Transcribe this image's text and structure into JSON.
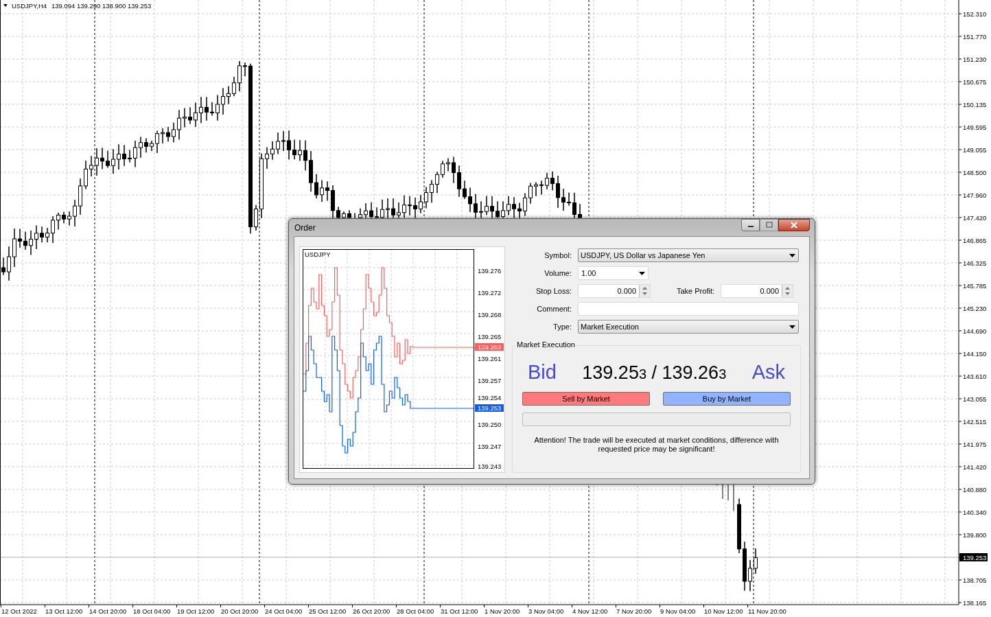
{
  "chart": {
    "header": {
      "symbol": "USDJPY,H4",
      "prices": "139.094 139.290 138.900 139.253"
    },
    "price_axis": [
      {
        "label": "152.310",
        "current": false
      },
      {
        "label": "151.770",
        "current": false
      },
      {
        "label": "151.230",
        "current": false
      },
      {
        "label": "150.675",
        "current": false
      },
      {
        "label": "150.135",
        "current": false
      },
      {
        "label": "149.595",
        "current": false
      },
      {
        "label": "149.055",
        "current": false
      },
      {
        "label": "148.500",
        "current": false
      },
      {
        "label": "147.960",
        "current": false
      },
      {
        "label": "147.420",
        "current": false
      },
      {
        "label": "146.865",
        "current": false
      },
      {
        "label": "146.325",
        "current": false
      },
      {
        "label": "145.785",
        "current": false
      },
      {
        "label": "145.230",
        "current": false
      },
      {
        "label": "144.690",
        "current": false
      },
      {
        "label": "144.150",
        "current": false
      },
      {
        "label": "143.610",
        "current": false
      },
      {
        "label": "143.055",
        "current": false
      },
      {
        "label": "142.515",
        "current": false
      },
      {
        "label": "141.975",
        "current": false
      },
      {
        "label": "141.420",
        "current": false
      },
      {
        "label": "140.880",
        "current": false
      },
      {
        "label": "140.340",
        "current": false
      },
      {
        "label": "139.800",
        "current": false
      },
      {
        "label": "139.253",
        "current": true
      },
      {
        "label": "138.705",
        "current": false
      },
      {
        "label": "138.165",
        "current": false
      }
    ],
    "time_axis": [
      "12 Oct 2022",
      "13 Oct 12:00",
      "14 Oct 20:00",
      "18 Oct 04:00",
      "19 Oct 12:00",
      "20 Oct 20:00",
      "24 Oct 04:00",
      "25 Oct 12:00",
      "26 Oct 20:00",
      "28 Oct 04:00",
      "31 Oct 12:00",
      "1 Nov 20:00",
      "3 Nov 04:00",
      "4 Nov 12:00",
      "7 Nov 20:00",
      "9 Nov 04:00",
      "10 Nov 12:00",
      "11 Nov 20:00"
    ]
  },
  "order_dialog": {
    "title": "Order",
    "window_buttons": [
      {
        "kind": "minimize",
        "disabled": false
      },
      {
        "kind": "maximize",
        "disabled": true
      },
      {
        "kind": "close",
        "disabled": false
      }
    ],
    "tick_chart": {
      "symbol": "USDJPY",
      "price_labels": [
        "139.276",
        "139.272",
        "139.268",
        "139.265",
        "139.261",
        "139.257",
        "139.254",
        "139.250",
        "139.247",
        "139.243"
      ],
      "ask_label": "139.263",
      "bid_label": "139.253"
    },
    "form": {
      "symbol": {
        "label": "Symbol:",
        "value": "USDJPY, US Dollar vs Japanese Yen"
      },
      "volume": {
        "label": "Volume:",
        "value": "1.00"
      },
      "stop_loss": {
        "label": "Stop Loss:",
        "value": "0.000"
      },
      "take_profit": {
        "label": "Take Profit:",
        "value": "0.000"
      },
      "comment": {
        "label": "Comment:"
      },
      "type": {
        "label": "Type:",
        "value": "Market Execution"
      }
    },
    "market_execution": {
      "title": "Market Execution",
      "bid_label": "Bid",
      "ask_label": "Ask",
      "quote": {
        "bid": "139.25",
        "bid_last": "3",
        "separator": "/",
        "ask": "139.26",
        "ask_last": "3"
      },
      "sell_button": "Sell by Market",
      "buy_button": "Buy by Market",
      "progress": {
        "level": 0
      },
      "notice": "Attention! The trade will be executed at market conditions, difference with requested price may be significant!"
    }
  }
}
